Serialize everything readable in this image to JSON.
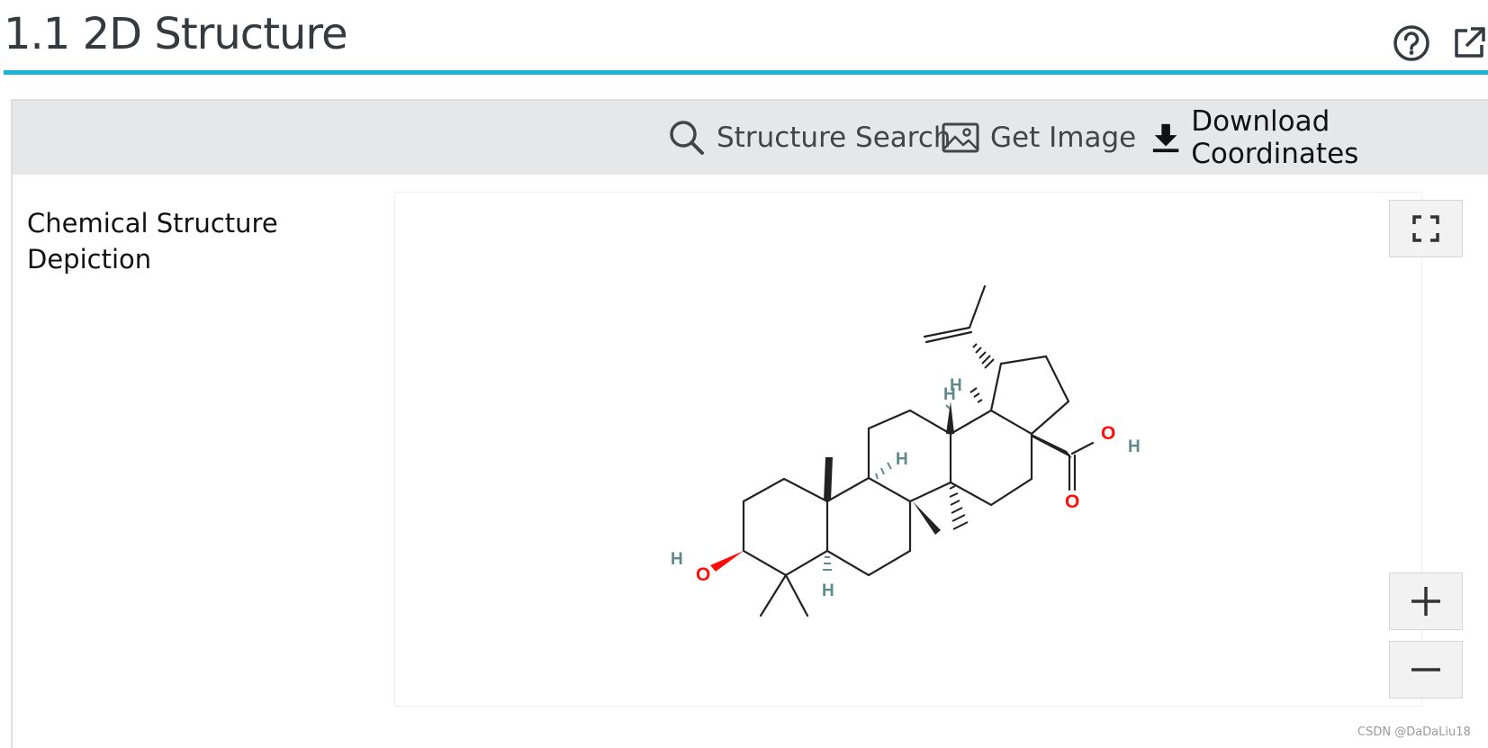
{
  "section": {
    "title": "1.1 2D Structure",
    "accent_color": "#1ab4d9",
    "icons": [
      "help-icon",
      "open-in-new-window-icon"
    ]
  },
  "toolbar": {
    "structure_search_label": "Structure Search",
    "get_image_label": "Get Image",
    "download_coordinates_label": "Download Coordinates",
    "icons": [
      "search-icon",
      "image-icon",
      "download-icon"
    ]
  },
  "row": {
    "label": "Chemical Structure Depiction"
  },
  "viewer": {
    "controls": [
      "fullscreen-icon",
      "plus-icon",
      "minus-icon"
    ],
    "atom_labels": {
      "oxygen": "O",
      "hydrogen": "H"
    },
    "atom_colors": {
      "oxygen": "#ff0d0d",
      "hydrogen": "#5f8a8b",
      "bond": "#222222"
    }
  },
  "watermark": "CSDN @DaDaLiu18"
}
